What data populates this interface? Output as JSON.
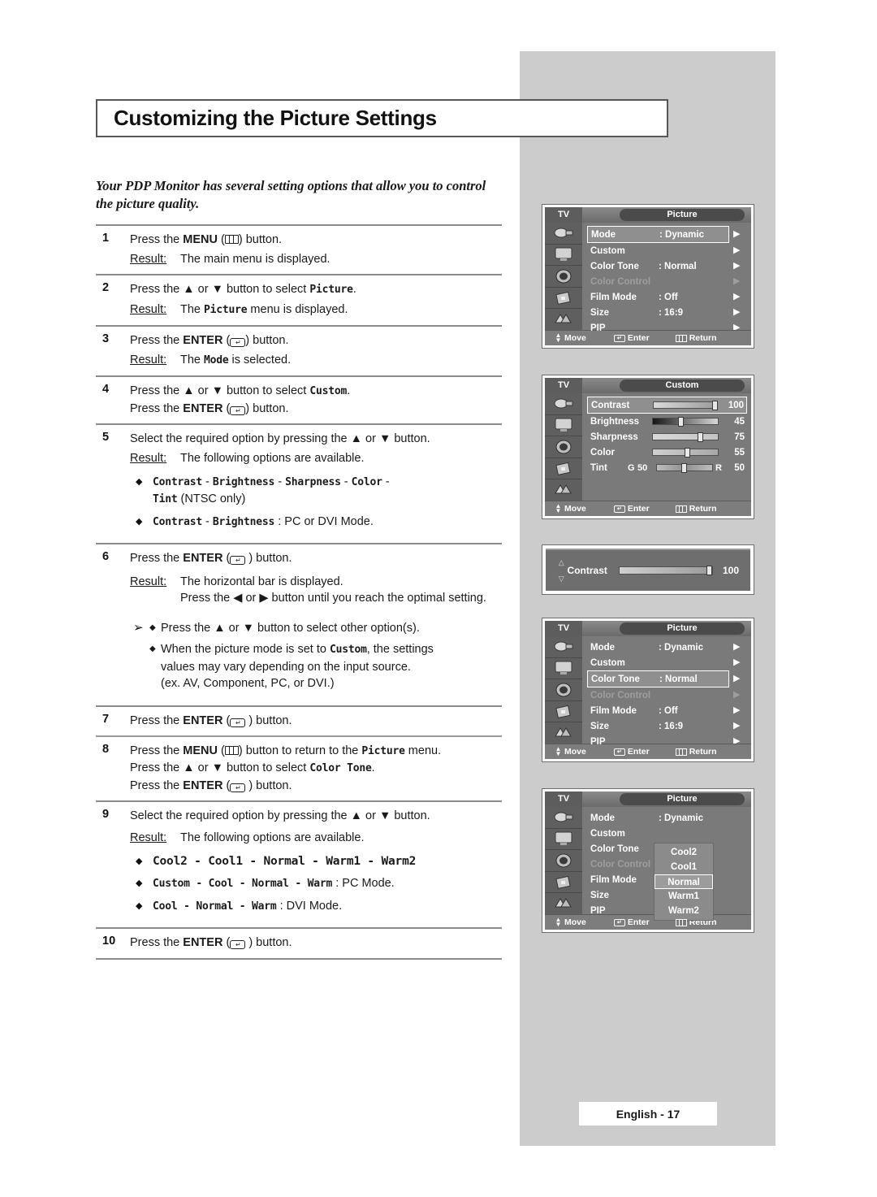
{
  "page": {
    "title": "Customizing the Picture Settings",
    "intro": "Your PDP Monitor has several setting options that allow you to control the picture quality.",
    "footer": "English - 17"
  },
  "steps": [
    {
      "num": "1",
      "lines": [
        "Press the MENU (   ) button."
      ],
      "result_label": "Result:",
      "result_text": "The main menu is displayed."
    },
    {
      "num": "2",
      "lines": [
        "Press the ▲ or ▼ button to select Picture."
      ],
      "result_label": "Result:",
      "result_text": "The Picture menu is displayed."
    },
    {
      "num": "3",
      "lines": [
        "Press the ENTER (   ) button."
      ],
      "result_label": "Result:",
      "result_text": "The Mode is selected."
    },
    {
      "num": "4",
      "lines": [
        "Press the ▲ or ▼ button to select Custom.",
        "Press the ENTER (   ) button."
      ]
    },
    {
      "num": "5",
      "lines": [
        "Select the required option by pressing the ▲ or ▼ button."
      ],
      "result_label": "Result:",
      "result_text": "The following options are available.",
      "bullets": [
        {
          "mono": "Contrast - Brightness - Sharpness - Color - ",
          "mono2": "Tint",
          "plain": " (NTSC only)"
        },
        {
          "mono": "Contrast - Brightness",
          "plain": " : PC or DVI Mode."
        }
      ]
    },
    {
      "num": "6",
      "lines": [
        "Press the ENTER (   ) button."
      ],
      "result_label": "Result:",
      "result_text": "The horizontal bar is displayed.",
      "result_text2": "Press the ◀ or ▶ button until you reach the optimal setting."
    },
    {
      "num": "7",
      "lines": [
        "Press the ENTER (   ) button."
      ]
    },
    {
      "num": "8",
      "lines": [
        "Press the MENU (   ) button to return to the Picture menu.",
        "Press the ▲ or ▼ button to select Color Tone.",
        "Press the ENTER (   ) button."
      ]
    },
    {
      "num": "9",
      "lines": [
        "Select the required option by pressing the ▲ or ▼ button."
      ],
      "result_label": "Result:",
      "result_text": "The following options are available.",
      "bullets": [
        {
          "mono": "Cool2 - Cool1 - Normal - Warm1 - Warm2",
          "plain": ""
        },
        {
          "mono": "Custom - Cool - Normal - Warm",
          "plain": " : PC Mode."
        },
        {
          "mono": "Cool - Normal - Warm",
          "plain": " : DVI Mode."
        }
      ]
    },
    {
      "num": "10",
      "lines": [
        "Press the ENTER (   ) button."
      ]
    }
  ],
  "note": {
    "arrow": "➢",
    "items": [
      {
        "diamond": "♦",
        "text": "Press the ▲ or ▼ button to select other option(s)."
      },
      {
        "diamond": "♦",
        "text_pre": "When the picture mode is set to ",
        "mono": "Custom",
        "text_post": ", the settings values may vary depending on the input source. (ex. AV, Component, PC, or DVI.)"
      }
    ]
  },
  "osd_common": {
    "tv_label": "TV",
    "footer": {
      "move": "Move",
      "enter": "Enter",
      "return": "Return"
    },
    "arrow_glyph": "▶"
  },
  "osd_panels": [
    {
      "id": "picture-mode-selected",
      "tab_title": "Picture",
      "rows": [
        {
          "label": "Mode",
          "value": ": Dynamic",
          "selected": true,
          "dim": false,
          "arrow": true
        },
        {
          "label": "Custom",
          "value": "",
          "selected": false,
          "dim": false,
          "arrow": true
        },
        {
          "label": "Color Tone",
          "value": ": Normal",
          "selected": false,
          "dim": false,
          "arrow": true
        },
        {
          "label": "Color Control",
          "value": "",
          "selected": false,
          "dim": true,
          "arrow": true
        },
        {
          "label": "Film Mode",
          "value": ": Off",
          "selected": false,
          "dim": false,
          "arrow": true
        },
        {
          "label": "Size",
          "value": ": 16:9",
          "selected": false,
          "dim": false,
          "arrow": true
        },
        {
          "label": "PIP",
          "value": "",
          "selected": false,
          "dim": false,
          "arrow": true
        }
      ]
    },
    {
      "id": "custom-sliders",
      "tab_title": "Custom",
      "sliders": [
        {
          "label": "Contrast",
          "value": "100",
          "pct": 97,
          "selected": true
        },
        {
          "label": "Brightness",
          "value": "45",
          "pct": 44,
          "selected": false
        },
        {
          "label": "Sharpness",
          "value": "75",
          "pct": 74,
          "selected": false
        },
        {
          "label": "Color",
          "value": "55",
          "pct": 54,
          "selected": false
        },
        {
          "label": "Tint",
          "value": "50",
          "left_label": "G",
          "left_value": "50",
          "right_label": "R",
          "pct": 50,
          "selected": false,
          "is_tint": true
        }
      ]
    },
    {
      "id": "contrast-bar",
      "label": "Contrast",
      "value": "100",
      "pct": 97,
      "up_glyph": "△",
      "down_glyph": "▽"
    },
    {
      "id": "picture-colortone-selected",
      "tab_title": "Picture",
      "rows": [
        {
          "label": "Mode",
          "value": ": Dynamic",
          "selected": false,
          "dim": false,
          "arrow": true
        },
        {
          "label": "Custom",
          "value": "",
          "selected": false,
          "dim": false,
          "arrow": true
        },
        {
          "label": "Color Tone",
          "value": ": Normal",
          "selected": true,
          "dim": false,
          "arrow": true
        },
        {
          "label": "Color Control",
          "value": "",
          "selected": false,
          "dim": true,
          "arrow": true
        },
        {
          "label": "Film Mode",
          "value": ": Off",
          "selected": false,
          "dim": false,
          "arrow": true
        },
        {
          "label": "Size",
          "value": ": 16:9",
          "selected": false,
          "dim": false,
          "arrow": true
        },
        {
          "label": "PIP",
          "value": "",
          "selected": false,
          "dim": false,
          "arrow": true
        }
      ]
    },
    {
      "id": "picture-colortone-dropdown",
      "tab_title": "Picture",
      "rows": [
        {
          "label": "Mode",
          "value": ": Dynamic",
          "selected": false,
          "dim": false,
          "arrow": false
        },
        {
          "label": "Custom",
          "value": "",
          "selected": false,
          "dim": false,
          "arrow": false
        },
        {
          "label": "Color Tone",
          "value": ":",
          "selected": false,
          "dim": false,
          "arrow": false
        },
        {
          "label": "Color Control",
          "value": "",
          "selected": false,
          "dim": true,
          "arrow": false
        },
        {
          "label": "Film Mode",
          "value": ":",
          "selected": false,
          "dim": false,
          "arrow": false
        },
        {
          "label": "Size",
          "value": ":",
          "selected": false,
          "dim": false,
          "arrow": false
        },
        {
          "label": "PIP",
          "value": "",
          "selected": false,
          "dim": false,
          "arrow": false
        }
      ],
      "dropdown": [
        {
          "label": "Cool2",
          "selected": false
        },
        {
          "label": "Cool1",
          "selected": false
        },
        {
          "label": "Normal",
          "selected": true
        },
        {
          "label": "Warm1",
          "selected": false
        },
        {
          "label": "Warm2",
          "selected": false
        }
      ]
    }
  ]
}
